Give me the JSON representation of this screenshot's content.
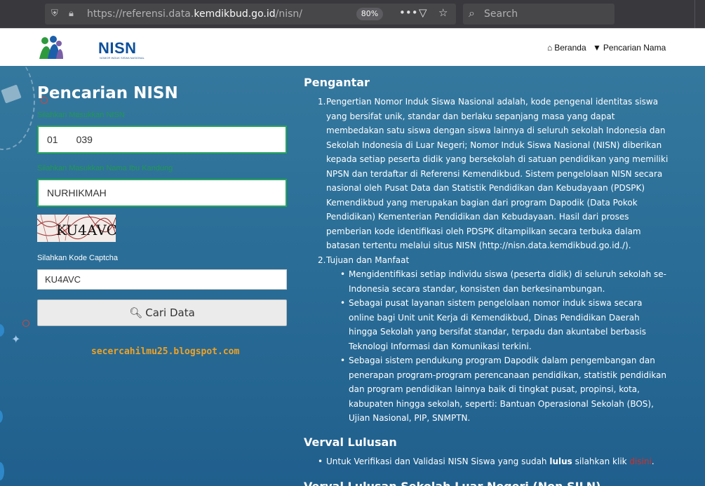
{
  "browser": {
    "url_prefix": "https://referensi.data.",
    "url_domain": "kemdikbud.go.id",
    "url_path": "/nisn/",
    "zoom": "80%",
    "search_placeholder": "Search"
  },
  "header": {
    "logo_text": "NISN",
    "logo_sub": "NOMOR INDUK SISWA NASIONAL",
    "nav": [
      {
        "label": "Beranda",
        "icon": "home-icon"
      },
      {
        "label": "Pencarian Nama",
        "icon": "filter-icon"
      }
    ]
  },
  "form": {
    "title": "Pencarian NISN",
    "nisn_label": "Silahkan Masukkan NISN",
    "nisn_value_start": "01",
    "nisn_value_end": "039",
    "name_label": "Silahkan Masukkan Nama Ibu Kandung",
    "name_value": "NURHIKMAH",
    "captcha_image_text": "KU4AVC",
    "captcha_label": "Silahkan Kode Captcha",
    "captcha_value": "KU4AVC",
    "submit_label": "Cari Data"
  },
  "watermark": "secercahilmu25.blogspot.com",
  "content": {
    "pengantar_title": "Pengantar",
    "item1_num": "1.",
    "item1_text": "Pengertian Nomor Induk Siswa Nasional adalah, kode pengenal identitas siswa yang bersifat unik, standar dan berlaku sepanjang masa yang dapat membedakan satu siswa dengan siswa lainnya di seluruh sekolah Indonesia dan Sekolah Indonesia di Luar Negeri; Nomor Induk Siswa Nasional (NISN) diberikan kepada setiap peserta didik yang bersekolah di satuan pendidikan yang memiliki NPSN dan terdaftar di Referensi Kemendikbud. Sistem pengelolaan NISN secara nasional oleh Pusat Data dan Statistik Pendidikan dan Kebudayaan (PDSPK) Kemendikbud yang merupakan bagian dari program Dapodik (Data Pokok Pendidikan) Kementerian Pendidikan dan Kebudayaan. Hasil dari proses pemberian kode identifikasi oleh PDSPK ditampilkan secara terbuka dalam batasan tertentu melalui situs NISN (http://nisn.data.kemdikbud.go.id./).",
    "item2_num": "2.",
    "item2_title": "Tujuan dan Manfaat",
    "bullets": [
      "Mengidentifikasi setiap individu siswa (peserta didik) di seluruh sekolah se-Indonesia secara standar, konsisten dan berkesinambungan.",
      "Sebagai pusat layanan sistem pengelolaan nomor induk siswa secara online bagi Unit unit Kerja di Kemendikbud, Dinas Pendidikan Daerah hingga Sekolah yang bersifat standar, terpadu dan akuntabel berbasis Teknologi Informasi dan Komunikasi terkini.",
      "Sebagai sistem pendukung program Dapodik dalam pengembangan dan penerapan program-program perencanaan pendidikan, statistik pendidikan dan program pendidikan lainnya baik di tingkat pusat, propinsi, kota, kabupaten hingga sekolah, seperti: Bantuan Operasional Sekolah (BOS), Ujian Nasional, PIP, SNMPTN."
    ],
    "verval_title": "Verval Lulusan",
    "verval_text_1": "Untuk Verifikasi dan Validasi NISN Siswa yang sudah ",
    "verval_bold": "lulus",
    "verval_text_2": " silahkan klik ",
    "verval_link": "disini",
    "verval_text_3": ".",
    "verval_ln_title": "Verval Lulusan Sekolah Luar Negeri (Non SILN)"
  }
}
